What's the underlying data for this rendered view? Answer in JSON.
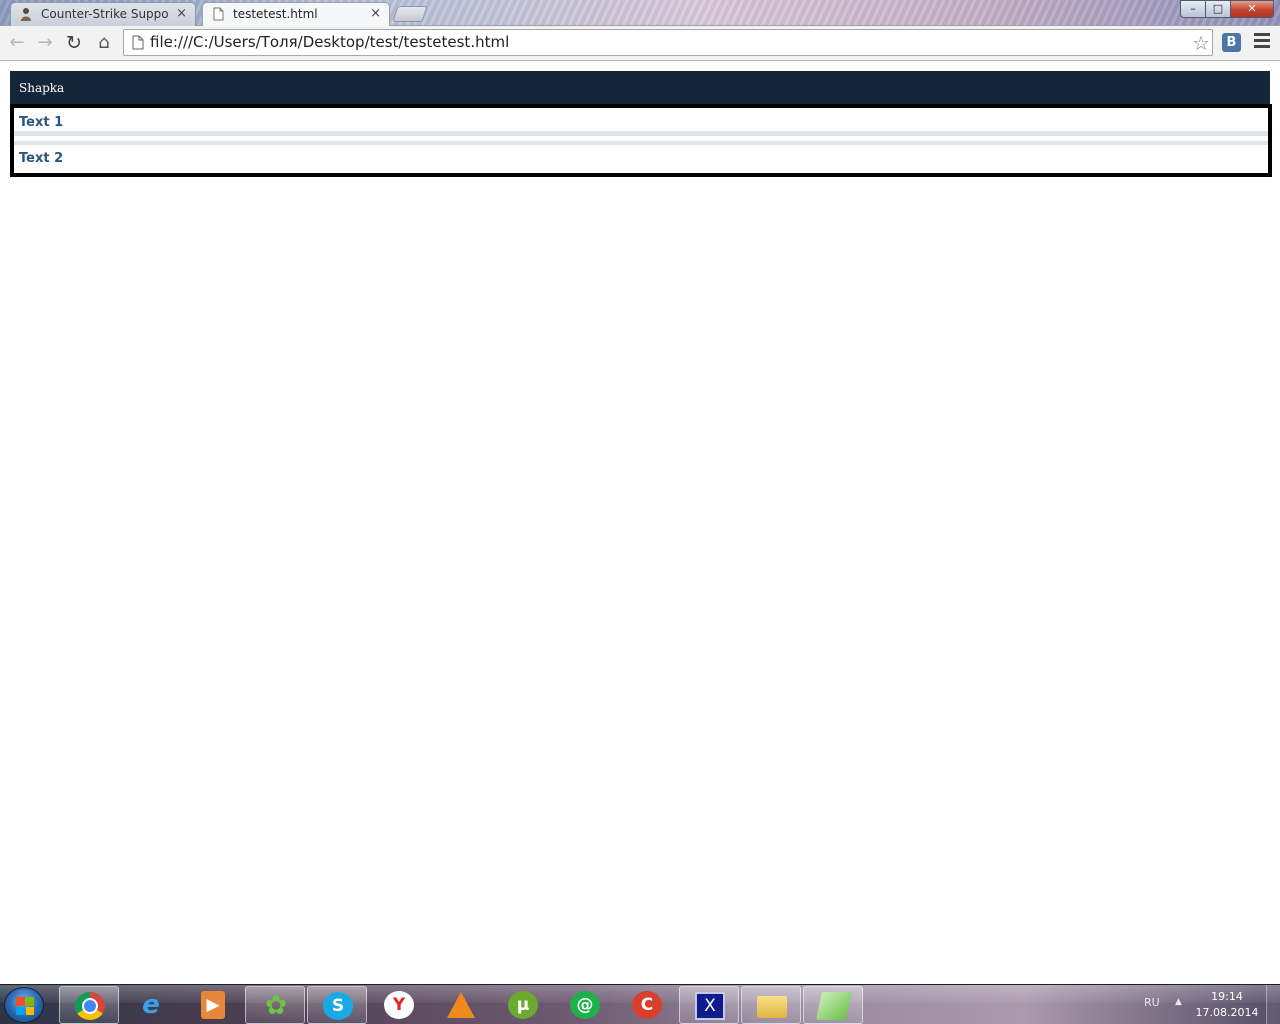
{
  "browser": {
    "tabs": [
      {
        "label": "Counter-Strike Support Co",
        "close": "×",
        "icon": "person-favicon-icon"
      },
      {
        "label": "testetest.html",
        "close": "×",
        "icon": "page-favicon-icon"
      }
    ],
    "window_controls": {
      "minimize": "–",
      "maximize": "□",
      "close": "✕"
    },
    "toolbar": {
      "back_icon": "←",
      "forward_icon": "→",
      "reload_icon": "↻",
      "home_icon": "⌂",
      "url": "file:///C:/Users/Толя/Desktop/test/testetest.html",
      "bookmark_icon": "☆",
      "extension_label": "B"
    }
  },
  "page": {
    "header": "Shapka",
    "rows": [
      "Text 1",
      "Text 2"
    ]
  },
  "taskbar": {
    "items": [
      {
        "name": "chrome",
        "glyph": ""
      },
      {
        "name": "internet-explorer",
        "glyph": "e"
      },
      {
        "name": "media-player",
        "glyph": "▶"
      },
      {
        "name": "icq",
        "glyph": "✿"
      },
      {
        "name": "skype",
        "glyph": "S"
      },
      {
        "name": "yandex",
        "glyph": "Y"
      },
      {
        "name": "vlc",
        "glyph": ""
      },
      {
        "name": "utorrent",
        "glyph": "µ"
      },
      {
        "name": "mail-agent",
        "glyph": "@"
      },
      {
        "name": "ccleaner",
        "glyph": "C"
      },
      {
        "name": "xdesk",
        "glyph": "X"
      },
      {
        "name": "file-explorer",
        "glyph": ""
      },
      {
        "name": "notepad",
        "glyph": ""
      }
    ],
    "language": "RU",
    "tray_arrow": "▲",
    "time": "19:14",
    "date": "17.08.2014"
  },
  "colors": {
    "header_bg": "#15263a",
    "row_text": "#29567a",
    "row_separator": "#dde6ea",
    "box_border": "#000000"
  }
}
